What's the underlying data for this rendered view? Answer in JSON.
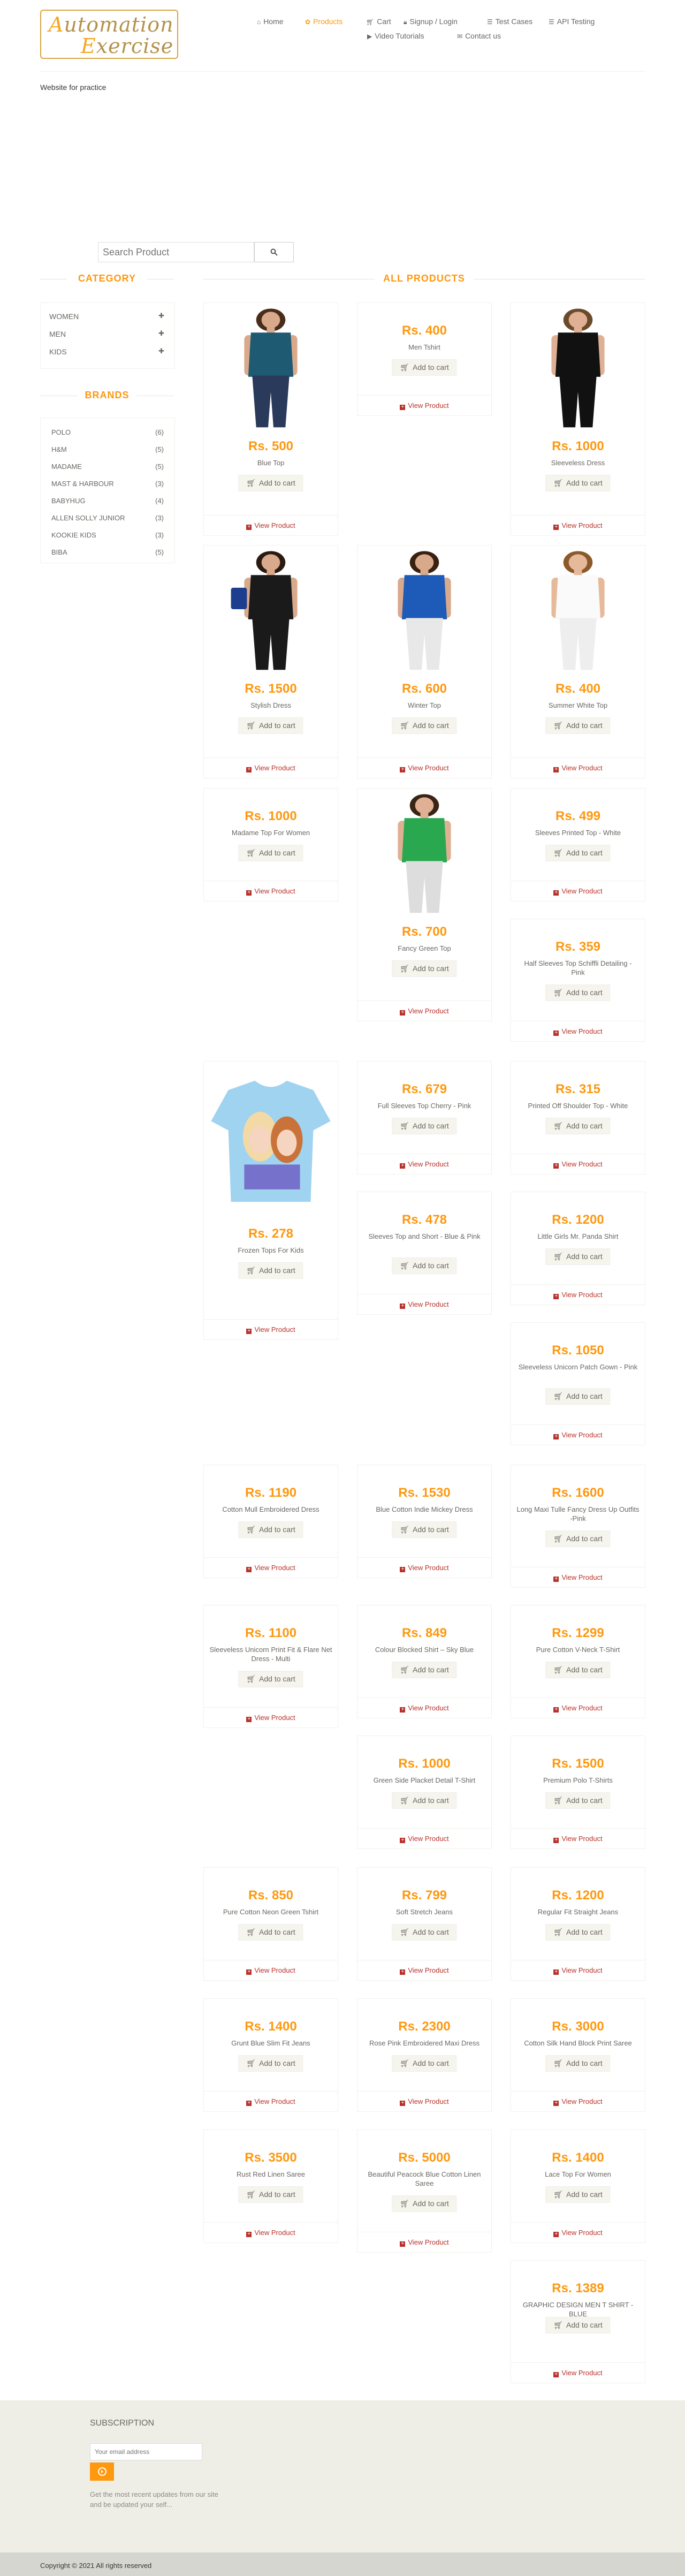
{
  "header": {
    "logo_line1": "Automation",
    "logo_line2": "Exercise",
    "nav": [
      {
        "label": "Home",
        "icon": "home-icon",
        "active": false
      },
      {
        "label": "Products",
        "icon": "products-icon",
        "active": true
      },
      {
        "label": "Cart",
        "icon": "cart-icon",
        "active": false
      },
      {
        "label": "Signup / Login",
        "icon": "lock-icon",
        "active": false
      },
      {
        "label": "Test Cases",
        "icon": "list-icon",
        "active": false
      },
      {
        "label": "API Testing",
        "icon": "list-icon",
        "active": false
      },
      {
        "label": "Video Tutorials",
        "icon": "youtube-icon",
        "active": false
      },
      {
        "label": "Contact us",
        "icon": "envelope-icon",
        "active": false
      }
    ]
  },
  "tagline": "Website for practice",
  "search": {
    "placeholder": "Search Product"
  },
  "sidebar": {
    "category_title": "CATEGORY",
    "categories": [
      "WOMEN",
      "MEN",
      "KIDS"
    ],
    "brands_title": "BRANDS",
    "brands": [
      {
        "name": "POLO",
        "count": "(6)"
      },
      {
        "name": "H&M",
        "count": "(5)"
      },
      {
        "name": "MADAME",
        "count": "(5)"
      },
      {
        "name": "MAST & HARBOUR",
        "count": "(3)"
      },
      {
        "name": "BABYHUG",
        "count": "(4)"
      },
      {
        "name": "ALLEN SOLLY JUNIOR",
        "count": "(3)"
      },
      {
        "name": "KOOKIE KIDS",
        "count": "(3)"
      },
      {
        "name": "BIBA",
        "count": "(5)"
      }
    ]
  },
  "products_title": "ALL PRODUCTS",
  "add_to_cart_label": "Add to cart",
  "view_product_label": "View Product",
  "products": [
    {
      "price": "Rs. 500",
      "name": "Blue Top",
      "image": "woman-blue-top"
    },
    {
      "price": "Rs. 400",
      "name": "Men Tshirt",
      "image": ""
    },
    {
      "price": "Rs. 1000",
      "name": "Sleeveless Dress",
      "image": "woman-black-sleeveless"
    },
    {
      "price": "Rs. 1500",
      "name": "Stylish Dress",
      "image": "woman-black-dress"
    },
    {
      "price": "Rs. 600",
      "name": "Winter Top",
      "image": "woman-blue-winter-top"
    },
    {
      "price": "Rs. 400",
      "name": "Summer White Top",
      "image": "woman-white-top"
    },
    {
      "price": "Rs. 1000",
      "name": "Madame Top For Women",
      "image": ""
    },
    {
      "price": "Rs. 700",
      "name": "Fancy Green Top",
      "image": "woman-green-top"
    },
    {
      "price": "Rs. 499",
      "name": "Sleeves Printed Top - White",
      "image": ""
    },
    {
      "price": "Rs. 359",
      "name": "Half Sleeves Top Schiffli Detailing - Pink",
      "image": ""
    },
    {
      "price": "Rs. 278",
      "name": "Frozen Tops For Kids",
      "image": "kids-frozen-top"
    },
    {
      "price": "Rs. 679",
      "name": "Full Sleeves Top Cherry - Pink",
      "image": ""
    },
    {
      "price": "Rs. 315",
      "name": "Printed Off Shoulder Top - White",
      "image": ""
    },
    {
      "price": "Rs. 478",
      "name": "Sleeves Top and Short - Blue & Pink",
      "image": ""
    },
    {
      "price": "Rs. 1200",
      "name": "Little Girls Mr. Panda Shirt",
      "image": ""
    },
    {
      "price": "Rs. 1050",
      "name": "Sleeveless Unicorn Patch Gown - Pink",
      "image": ""
    },
    {
      "price": "Rs. 1190",
      "name": "Cotton Mull Embroidered Dress",
      "image": ""
    },
    {
      "price": "Rs. 1530",
      "name": "Blue Cotton Indie Mickey Dress",
      "image": ""
    },
    {
      "price": "Rs. 1600",
      "name": "Long Maxi Tulle Fancy Dress Up Outfits -Pink",
      "image": ""
    },
    {
      "price": "Rs. 1100",
      "name": "Sleeveless Unicorn Print Fit & Flare Net Dress - Multi",
      "image": ""
    },
    {
      "price": "Rs. 849",
      "name": "Colour Blocked Shirt – Sky Blue",
      "image": ""
    },
    {
      "price": "Rs. 1299",
      "name": "Pure Cotton V-Neck T-Shirt",
      "image": ""
    },
    {
      "price": "Rs. 1000",
      "name": "Green Side Placket Detail T-Shirt",
      "image": ""
    },
    {
      "price": "Rs. 1500",
      "name": "Premium Polo T-Shirts",
      "image": ""
    },
    {
      "price": "Rs. 850",
      "name": "Pure Cotton Neon Green Tshirt",
      "image": ""
    },
    {
      "price": "Rs. 799",
      "name": "Soft Stretch Jeans",
      "image": ""
    },
    {
      "price": "Rs. 1200",
      "name": "Regular Fit Straight Jeans",
      "image": ""
    },
    {
      "price": "Rs. 1400",
      "name": "Grunt Blue Slim Fit Jeans",
      "image": ""
    },
    {
      "price": "Rs. 2300",
      "name": "Rose Pink Embroidered Maxi Dress",
      "image": ""
    },
    {
      "price": "Rs. 3000",
      "name": "Cotton Silk Hand Block Print Saree",
      "image": ""
    },
    {
      "price": "Rs. 3500",
      "name": "Rust Red Linen Saree",
      "image": ""
    },
    {
      "price": "Rs. 5000",
      "name": "Beautiful Peacock Blue Cotton Linen Saree",
      "image": ""
    },
    {
      "price": "Rs. 1400",
      "name": "Lace Top For Women",
      "image": ""
    },
    {
      "price": "Rs. 1389",
      "name": "GRAPHIC DESIGN MEN T SHIRT - BLUE",
      "image": ""
    }
  ],
  "footer": {
    "subscription_title": "SUBSCRIPTION",
    "email_placeholder": "Your email address",
    "subscribe_text": "Get the most recent updates from our site and be updated your self...",
    "copyright": "Copyright © 2021 All rights reserved"
  },
  "colors": {
    "accent": "#fe980f",
    "view_product": "#b8322b",
    "footer_bg": "#eeede6"
  }
}
